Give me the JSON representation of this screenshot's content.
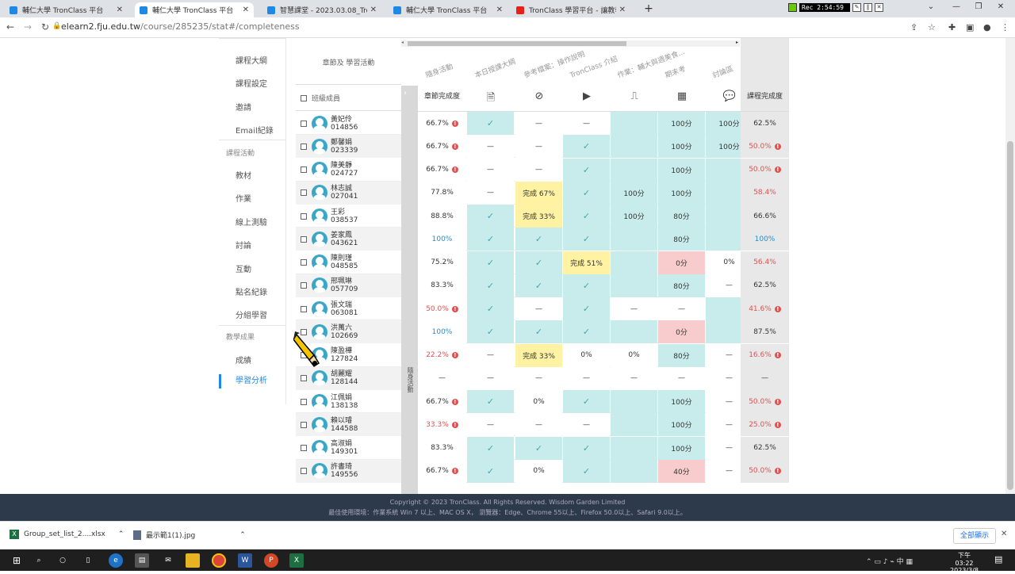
{
  "tabs": [
    {
      "title": "輔仁大學 TronClass 平台",
      "color": "#1e88e5",
      "active": false
    },
    {
      "title": "輔仁大學 TronClass 平台",
      "color": "#1e88e5",
      "active": true
    },
    {
      "title": "智慧課堂 - 2023.03.08_TronCla",
      "color": "#1e88e5",
      "active": false
    },
    {
      "title": "輔仁大學 TronClass 平台",
      "color": "#1e88e5",
      "active": false
    },
    {
      "title": "TronClass 學習平台 - 讓教學與生",
      "color": "#e62117",
      "active": false
    }
  ],
  "recorder": {
    "time": "Rec 2:54:59"
  },
  "address": {
    "domain": "elearn2.fju.edu.tw",
    "path": "/course/285235/stat#/completeness"
  },
  "sidebar": {
    "items": [
      "課程大綱",
      "課程設定",
      "邀請",
      "Email紀錄"
    ],
    "cat1": "課程活動",
    "activities": [
      "教材",
      "作業",
      "線上測驗",
      "討論",
      "互動",
      "點名紀錄",
      "分組學習"
    ],
    "cat2": "教學成果",
    "results": [
      "成績",
      "學習分析"
    ]
  },
  "table": {
    "header_title": "章節及 學習活動",
    "members_label": "班級成員",
    "chapter_completion": "章節完成度",
    "course_completion": "課程完成度",
    "group_label": "隨身活動",
    "activities": [
      "隨身活動",
      "本日授課大綱",
      "參考檔案：操作說明",
      "TronClass 介紹",
      "作業：輔大與週美食...",
      "期末考",
      "討論區"
    ],
    "icons": [
      "document-icon",
      "attachment-icon",
      "video-icon",
      "homework-icon",
      "exam-icon",
      "discussion-icon"
    ]
  },
  "rows": [
    {
      "name": "黃妃伶",
      "id": "014856",
      "chapter": "66.7%",
      "chapter_alert": true,
      "chapter_color": "normal",
      "cells": [
        [
          "check",
          "teal"
        ],
        [
          "—",
          "white"
        ],
        [
          "—",
          "white"
        ],
        [
          "",
          "teal"
        ],
        [
          "100分",
          "teal"
        ],
        [
          "100分",
          "teal"
        ]
      ],
      "course": "62.5%",
      "course_alert": false,
      "course_color": "normal"
    },
    {
      "name": "鄭馨娟",
      "id": "023339",
      "chapter": "66.7%",
      "chapter_alert": true,
      "chapter_color": "normal",
      "cells": [
        [
          "—",
          "white"
        ],
        [
          "—",
          "white"
        ],
        [
          "check",
          "teal"
        ],
        [
          "",
          "teal"
        ],
        [
          "100分",
          "teal"
        ],
        [
          "100分",
          "teal"
        ]
      ],
      "course": "50.0%",
      "course_alert": true,
      "course_color": "red"
    },
    {
      "name": "陳美靜",
      "id": "024727",
      "chapter": "66.7%",
      "chapter_alert": true,
      "chapter_color": "normal",
      "cells": [
        [
          "—",
          "white"
        ],
        [
          "—",
          "white"
        ],
        [
          "check",
          "teal"
        ],
        [
          "",
          "teal"
        ],
        [
          "100分",
          "teal"
        ],
        [
          "",
          "teal"
        ]
      ],
      "course": "50.0%",
      "course_alert": true,
      "course_color": "red"
    },
    {
      "name": "林志誠",
      "id": "027041",
      "chapter": "77.8%",
      "chapter_alert": false,
      "chapter_color": "normal",
      "cells": [
        [
          "—",
          "white"
        ],
        [
          "完成 67%",
          "yellow"
        ],
        [
          "check",
          "teal"
        ],
        [
          "100分",
          "teal"
        ],
        [
          "100分",
          "teal"
        ],
        [
          "",
          "teal"
        ]
      ],
      "course": "58.4%",
      "course_alert": false,
      "course_color": "red"
    },
    {
      "name": "王彩",
      "id": "038537",
      "chapter": "88.8%",
      "chapter_alert": false,
      "chapter_color": "normal",
      "cells": [
        [
          "check",
          "teal"
        ],
        [
          "完成 33%",
          "yellow"
        ],
        [
          "check",
          "teal"
        ],
        [
          "100分",
          "teal"
        ],
        [
          "80分",
          "teal"
        ],
        [
          "",
          "teal"
        ]
      ],
      "course": "66.6%",
      "course_alert": false,
      "course_color": "normal"
    },
    {
      "name": "姜家鳳",
      "id": "043621",
      "chapter": "100%",
      "chapter_alert": false,
      "chapter_color": "blue",
      "cells": [
        [
          "check",
          "teal"
        ],
        [
          "check",
          "teal"
        ],
        [
          "check",
          "teal"
        ],
        [
          "",
          "teal"
        ],
        [
          "80分",
          "teal"
        ],
        [
          "",
          "teal"
        ]
      ],
      "course": "100%",
      "course_alert": false,
      "course_color": "blue"
    },
    {
      "name": "陳則瑾",
      "id": "048585",
      "chapter": "75.2%",
      "chapter_alert": false,
      "chapter_color": "normal",
      "cells": [
        [
          "check",
          "teal"
        ],
        [
          "check",
          "teal"
        ],
        [
          "完成 51%",
          "yellow"
        ],
        [
          "",
          "teal"
        ],
        [
          "0分",
          "pink"
        ],
        [
          "0%",
          "white"
        ]
      ],
      "course": "56.4%",
      "course_alert": false,
      "course_color": "red"
    },
    {
      "name": "邢珮琳",
      "id": "057709",
      "chapter": "83.3%",
      "chapter_alert": false,
      "chapter_color": "normal",
      "cells": [
        [
          "check",
          "teal"
        ],
        [
          "check",
          "teal"
        ],
        [
          "check",
          "teal"
        ],
        [
          "",
          "teal"
        ],
        [
          "80分",
          "teal"
        ],
        [
          "—",
          "white"
        ]
      ],
      "course": "62.5%",
      "course_alert": false,
      "course_color": "normal"
    },
    {
      "name": "張文瑞",
      "id": "063081",
      "chapter": "50.0%",
      "chapter_alert": true,
      "chapter_color": "red",
      "cells": [
        [
          "check",
          "teal"
        ],
        [
          "—",
          "white"
        ],
        [
          "check",
          "teal"
        ],
        [
          "—",
          "white"
        ],
        [
          "—",
          "white"
        ],
        [
          "",
          "teal"
        ]
      ],
      "course": "41.6%",
      "course_alert": true,
      "course_color": "red"
    },
    {
      "name": "洪萬六",
      "id": "102669",
      "chapter": "100%",
      "chapter_alert": false,
      "chapter_color": "blue",
      "cells": [
        [
          "check",
          "teal"
        ],
        [
          "check",
          "teal"
        ],
        [
          "check",
          "teal"
        ],
        [
          "",
          "teal"
        ],
        [
          "0分",
          "pink"
        ],
        [
          "",
          "teal"
        ]
      ],
      "course": "87.5%",
      "course_alert": false,
      "course_color": "normal"
    },
    {
      "name": "陳盈樺",
      "id": "127824",
      "chapter": "22.2%",
      "chapter_alert": true,
      "chapter_color": "red",
      "cells": [
        [
          "—",
          "white"
        ],
        [
          "完成 33%",
          "yellow"
        ],
        [
          "0%",
          "white"
        ],
        [
          "0%",
          "white"
        ],
        [
          "80分",
          "teal"
        ],
        [
          "—",
          "white"
        ]
      ],
      "course": "16.6%",
      "course_alert": true,
      "course_color": "red"
    },
    {
      "name": "胡麗耀",
      "id": "128144",
      "chapter": "—",
      "chapter_alert": false,
      "chapter_color": "normal",
      "cells": [
        [
          "—",
          "white"
        ],
        [
          "—",
          "white"
        ],
        [
          "—",
          "white"
        ],
        [
          "—",
          "white"
        ],
        [
          "—",
          "white"
        ],
        [
          "—",
          "white"
        ]
      ],
      "course": "—",
      "course_alert": false,
      "course_color": "normal"
    },
    {
      "name": "江佩娟",
      "id": "138138",
      "chapter": "66.7%",
      "chapter_alert": true,
      "chapter_color": "normal",
      "cells": [
        [
          "check",
          "teal"
        ],
        [
          "0%",
          "white"
        ],
        [
          "check",
          "teal"
        ],
        [
          "",
          "teal"
        ],
        [
          "100分",
          "teal"
        ],
        [
          "—",
          "white"
        ]
      ],
      "course": "50.0%",
      "course_alert": true,
      "course_color": "red"
    },
    {
      "name": "賴以璿",
      "id": "144588",
      "chapter": "33.3%",
      "chapter_alert": true,
      "chapter_color": "red",
      "cells": [
        [
          "—",
          "white"
        ],
        [
          "—",
          "white"
        ],
        [
          "—",
          "white"
        ],
        [
          "",
          "teal"
        ],
        [
          "100分",
          "teal"
        ],
        [
          "—",
          "white"
        ]
      ],
      "course": "25.0%",
      "course_alert": true,
      "course_color": "red"
    },
    {
      "name": "高淑娟",
      "id": "149301",
      "chapter": "83.3%",
      "chapter_alert": false,
      "chapter_color": "normal",
      "cells": [
        [
          "check",
          "teal"
        ],
        [
          "check",
          "teal"
        ],
        [
          "check",
          "teal"
        ],
        [
          "",
          "teal"
        ],
        [
          "100分",
          "teal"
        ],
        [
          "—",
          "white"
        ]
      ],
      "course": "62.5%",
      "course_alert": false,
      "course_color": "normal"
    },
    {
      "name": "許書琦",
      "id": "149556",
      "chapter": "66.7%",
      "chapter_alert": true,
      "chapter_color": "normal",
      "cells": [
        [
          "check",
          "teal"
        ],
        [
          "0%",
          "white"
        ],
        [
          "check",
          "teal"
        ],
        [
          "",
          "teal"
        ],
        [
          "40分",
          "pink"
        ],
        [
          "—",
          "white"
        ]
      ],
      "course": "50.0%",
      "course_alert": true,
      "course_color": "red"
    }
  ],
  "footer": {
    "line1": "Copyright © 2023 TronClass. All Rights Reserved. Wisdom Garden Limited",
    "line2": "最佳使用環境：作業系統 Win 7 以上、MAC OS X， 瀏覽器：Edge、Chrome 55以上、Firefox 50.0以上、Safari 9.0以上。"
  },
  "downloads": [
    {
      "name": "Group_set_list_2....xlsx",
      "color": "#1d6f42"
    },
    {
      "name": "最示範1(1).jpg",
      "color": "#5b6b8a"
    }
  ],
  "show_all": "全部顯示",
  "clock": {
    "time": "下午 03:22",
    "date": "2023/3/8"
  }
}
